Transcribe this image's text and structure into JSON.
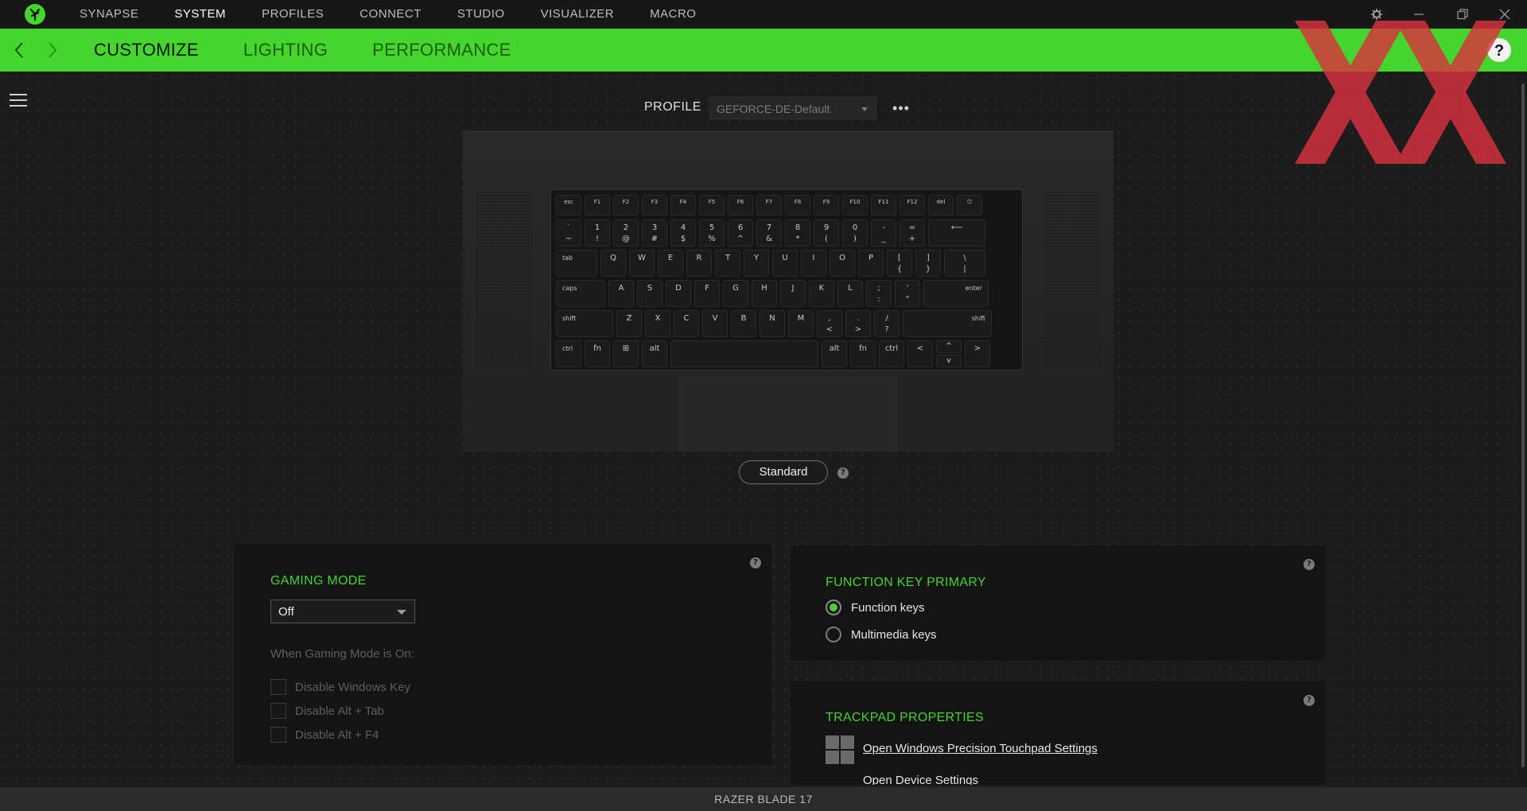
{
  "app": {
    "nav_tabs": [
      "SYNAPSE",
      "SYSTEM",
      "PROFILES",
      "CONNECT",
      "STUDIO",
      "VISUALIZER",
      "MACRO"
    ],
    "active_nav": "SYSTEM"
  },
  "subnav": {
    "tabs": [
      "CUSTOMIZE",
      "LIGHTING",
      "PERFORMANCE"
    ],
    "active": "CUSTOMIZE"
  },
  "profile": {
    "label": "PROFILE",
    "selected": "GEFORCE-DE-Default",
    "more": "•••"
  },
  "keyboard": {
    "row0": [
      "esc",
      "F1",
      "F2",
      "F3",
      "F4",
      "F5",
      "F6",
      "F7",
      "F8",
      "F9",
      "F10",
      "F11",
      "F12",
      "del",
      "⏻"
    ],
    "row1": [
      "`\n~",
      "1\n!",
      "2\n@",
      "3\n#",
      "4\n$",
      "5\n%",
      "6\n^",
      "7\n&",
      "8\n*",
      "9\n(",
      "0\n)",
      "-\n_",
      "=\n+",
      "⟵"
    ],
    "row2": [
      "tab",
      "Q",
      "W",
      "E",
      "R",
      "T",
      "Y",
      "U",
      "I",
      "O",
      "P",
      "[\n{",
      "]\n}",
      "\\\n|"
    ],
    "row3": [
      "caps",
      "A",
      "S",
      "D",
      "F",
      "G",
      "H",
      "J",
      "K",
      "L",
      ";\n:",
      "'\n\"",
      "enter"
    ],
    "row4": [
      "shift",
      "Z",
      "X",
      "C",
      "V",
      "B",
      "N",
      "M",
      ",\n<",
      ".\n>",
      "/\n?",
      "shift"
    ],
    "row5": [
      "ctrl",
      "fn",
      "⊞",
      "alt",
      "",
      "alt",
      "fn",
      "ctrl",
      "<",
      "^",
      "v",
      ">"
    ]
  },
  "mode_pill": "Standard",
  "help_glyph": "?",
  "gaming_mode": {
    "title": "GAMING MODE",
    "value": "Off",
    "subtitle": "When Gaming Mode is On:",
    "options": [
      "Disable Windows Key",
      "Disable Alt + Tab",
      "Disable Alt + F4"
    ]
  },
  "function_key": {
    "title": "FUNCTION KEY PRIMARY",
    "options": [
      "Function keys",
      "Multimedia keys"
    ],
    "selected_index": 0
  },
  "trackpad": {
    "title": "TRACKPAD PROPERTIES",
    "links": [
      "Open Windows Precision Touchpad Settings",
      "Open Device Settings"
    ]
  },
  "footer": {
    "device": "RAZER BLADE 17"
  },
  "colors": {
    "accent": "#44d62c",
    "watermark": "#d9333f"
  },
  "icons": [
    "razer-logo-icon",
    "gear-icon",
    "minimize-icon",
    "restore-icon",
    "close-icon",
    "back-arrow-icon",
    "forward-arrow-icon",
    "help-icon",
    "hamburger-icon",
    "windows-icon"
  ]
}
